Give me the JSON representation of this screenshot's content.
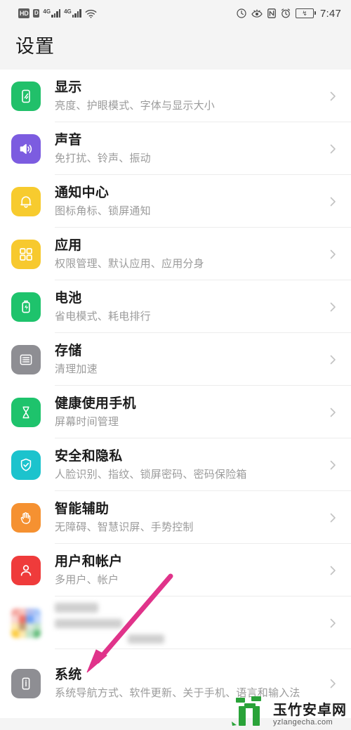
{
  "statusbar": {
    "hd_badge": "HD",
    "volte_badge": "D",
    "network_gen_1": "4G",
    "network_gen_2": "4G",
    "icons_left": [
      "hd-icon",
      "volte-icon",
      "signal-4g-icon",
      "signal-4g-icon",
      "wifi-icon"
    ],
    "icons_right": [
      "data-saver-icon",
      "eye-comfort-icon",
      "nfc-icon",
      "alarm-icon",
      "battery-saver-icon"
    ],
    "battery_glyph": "↯",
    "time": "7:47"
  },
  "header": {
    "title": "设置"
  },
  "list": {
    "items": [
      {
        "id": "display",
        "title": "显示",
        "subtitle": "亮度、护眼模式、字体与显示大小",
        "icon": "display-icon",
        "icon_color": "#21c06a"
      },
      {
        "id": "sound",
        "title": "声音",
        "subtitle": "免打扰、铃声、振动",
        "icon": "sound-icon",
        "icon_color": "#7c5ce0"
      },
      {
        "id": "notification-center",
        "title": "通知中心",
        "subtitle": "图标角标、锁屏通知",
        "icon": "bell-icon",
        "icon_color": "#f7cb2e"
      },
      {
        "id": "apps",
        "title": "应用",
        "subtitle": "权限管理、默认应用、应用分身",
        "icon": "apps-grid-icon",
        "icon_color": "#f7c92e"
      },
      {
        "id": "battery",
        "title": "电池",
        "subtitle": "省电模式、耗电排行",
        "icon": "battery-icon",
        "icon_color": "#1ec36c"
      },
      {
        "id": "storage",
        "title": "存储",
        "subtitle": "清理加速",
        "icon": "storage-icon",
        "icon_color": "#8e8e93"
      },
      {
        "id": "digital-balance",
        "title": "健康使用手机",
        "subtitle": "屏幕时间管理",
        "icon": "hourglass-icon",
        "icon_color": "#1ec36c"
      },
      {
        "id": "security-privacy",
        "title": "安全和隐私",
        "subtitle": "人脸识别、指纹、锁屏密码、密码保险箱",
        "icon": "shield-check-icon",
        "icon_color": "#1cc3cd"
      },
      {
        "id": "smart-assistance",
        "title": "智能辅助",
        "subtitle": "无障碍、智慧识屏、手势控制",
        "icon": "hand-icon",
        "icon_color": "#f59131"
      },
      {
        "id": "users-accounts",
        "title": "用户和帐户",
        "subtitle": "多用户、帐户",
        "icon": "user-icon",
        "icon_color": "#ef3b3b"
      },
      {
        "id": "censored-row",
        "title": "",
        "subtitle": "",
        "icon": "blurred-app-icon",
        "icon_color": "#cfcfcf",
        "censored": true
      },
      {
        "id": "system",
        "title": "系统",
        "subtitle": "系统导航方式、软件更新、关于手机、语言和输入法",
        "icon": "system-info-icon",
        "icon_color": "#8e8e93"
      }
    ]
  },
  "annotation": {
    "type": "arrow",
    "color": "#e0338a",
    "points_to": "system-row"
  },
  "watermark": {
    "name_cn": "玉竹安卓网",
    "name_en": "yzlangecha.com",
    "logo_color": "#2aa339"
  }
}
